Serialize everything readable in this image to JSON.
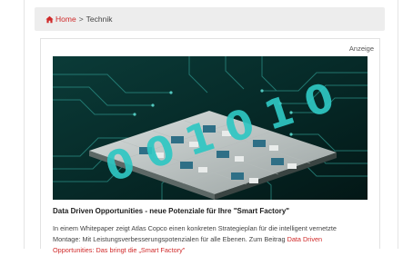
{
  "breadcrumb": {
    "home_label": "Home",
    "separator": ">",
    "current": "Technik",
    "link_color": "#d02a2a"
  },
  "ad": {
    "label": "Anzeige"
  },
  "hero": {
    "digits_text": "0 0 1 0 1 0",
    "background": "#062423",
    "accent": "#2fc7c3"
  },
  "article": {
    "headline": "Data Driven Opportunities - neue Potenziale für Ihre \"Smart Factory\"",
    "teaser_line1": "In einem Whitepaper zeigt Atlas Copco einen konkreten Strategieplan für die intelligent vernetzte",
    "teaser_line2_prefix": "Montage: Mit Leistungsverbesserungspotenzialen für alle Ebenen. Zum Beitrag ",
    "teaser_link_part1": "Data Driven",
    "teaser_link_part2": "Opportunities: Das bringt die „Smart Factory\""
  }
}
